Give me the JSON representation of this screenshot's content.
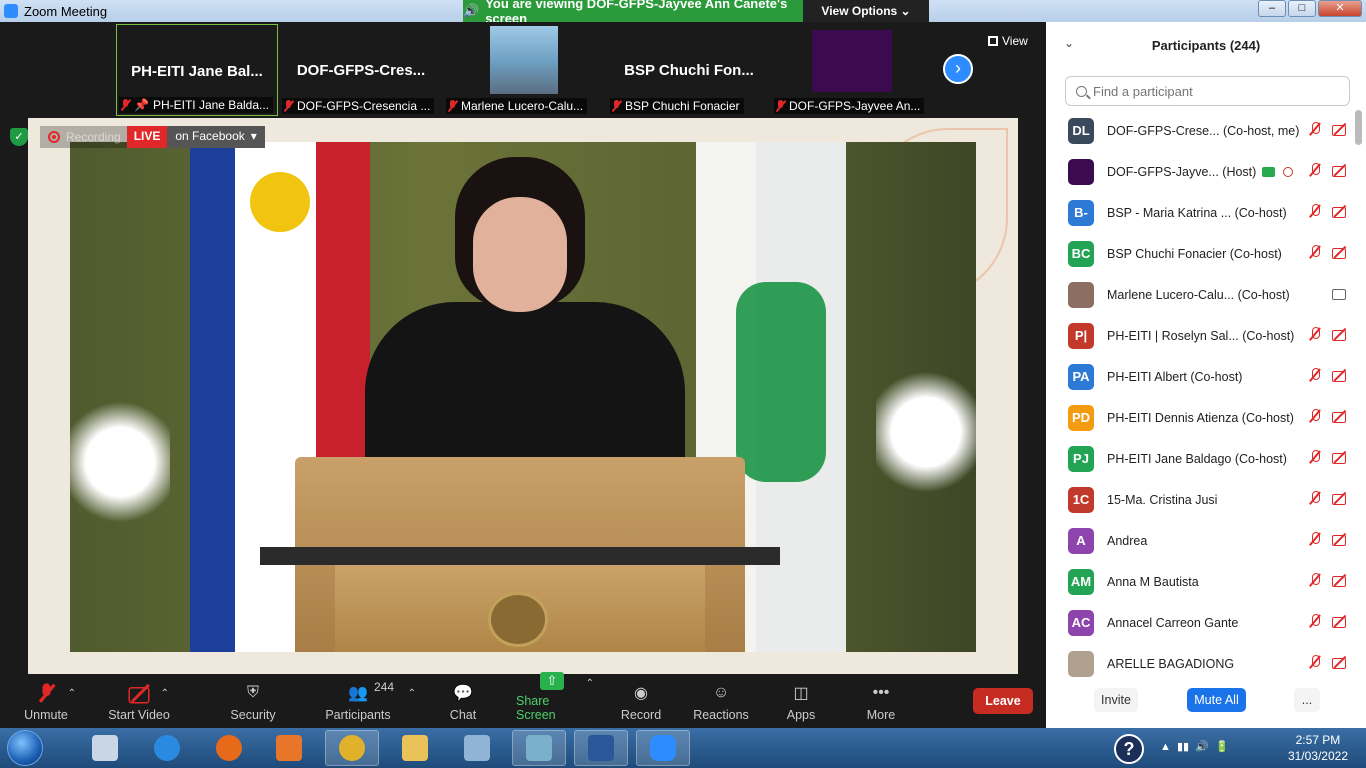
{
  "window": {
    "title": "Zoom Meeting"
  },
  "banner": {
    "viewing_text": "You are viewing DOF-GFPS-Jayvee Ann Canete's screen",
    "view_options": "View Options"
  },
  "gallery": {
    "tiles": [
      {
        "name": "PH-EITI Jane Bal...",
        "label": "PH-EITI Jane Balda..."
      },
      {
        "name": "DOF-GFPS-Cres...",
        "label": "DOF-GFPS-Cresencia ..."
      },
      {
        "name": "",
        "label": "Marlene Lucero-Calu..."
      },
      {
        "name": "BSP Chuchi Fon...",
        "label": "BSP Chuchi Fonacier"
      },
      {
        "name": "",
        "label": "DOF-GFPS-Jayvee An..."
      }
    ],
    "view_label": "View"
  },
  "recording": {
    "label": "Recording",
    "live": "LIVE",
    "live_target": "on Facebook"
  },
  "toolbar": {
    "unmute": "Unmute",
    "start_video": "Start Video",
    "security": "Security",
    "participants": "Participants",
    "participants_count": "244",
    "chat": "Chat",
    "share_screen": "Share Screen",
    "record": "Record",
    "reactions": "Reactions",
    "apps": "Apps",
    "more": "More",
    "leave": "Leave"
  },
  "panel": {
    "title": "Participants (244)",
    "search_placeholder": "Find a participant",
    "participants": [
      {
        "initials": "DL",
        "color": "#3a4a5c",
        "name": "DOF-GFPS-Crese...  (Co-host, me)"
      },
      {
        "initials": "",
        "color": "#3b0a4f",
        "name": "DOF-GFPS-Jayve... (Host)"
      },
      {
        "initials": "B-",
        "color": "#2d7ad6",
        "name": "BSP - Maria Katrina ...  (Co-host)"
      },
      {
        "initials": "BC",
        "color": "#23a455",
        "name": "BSP Chuchi Fonacier (Co-host)"
      },
      {
        "initials": "",
        "color": "#8d6e63",
        "name": "Marlene Lucero-Calu...  (Co-host)"
      },
      {
        "initials": "P|",
        "color": "#c0392b",
        "name": "PH-EITI | Roselyn Sal...  (Co-host)"
      },
      {
        "initials": "PA",
        "color": "#2d7ad6",
        "name": "PH-EITI Albert (Co-host)"
      },
      {
        "initials": "PD",
        "color": "#f39c12",
        "name": "PH-EITI Dennis Atienza (Co-host)"
      },
      {
        "initials": "PJ",
        "color": "#23a455",
        "name": "PH-EITI Jane Baldago (Co-host)"
      },
      {
        "initials": "1C",
        "color": "#c0392b",
        "name": "15-Ma. Cristina Jusi"
      },
      {
        "initials": "A",
        "color": "#8e44ad",
        "name": "Andrea"
      },
      {
        "initials": "AM",
        "color": "#23a455",
        "name": "Anna M Bautista"
      },
      {
        "initials": "AC",
        "color": "#8e44ad",
        "name": "Annacel Carreon Gante"
      },
      {
        "initials": "",
        "color": "#b0a090",
        "name": "ARELLE BAGADIONG"
      }
    ],
    "invite": "Invite",
    "mute_all": "Mute All",
    "more": "..."
  },
  "taskbar": {
    "time": "2:57 PM",
    "date": "31/03/2022"
  }
}
